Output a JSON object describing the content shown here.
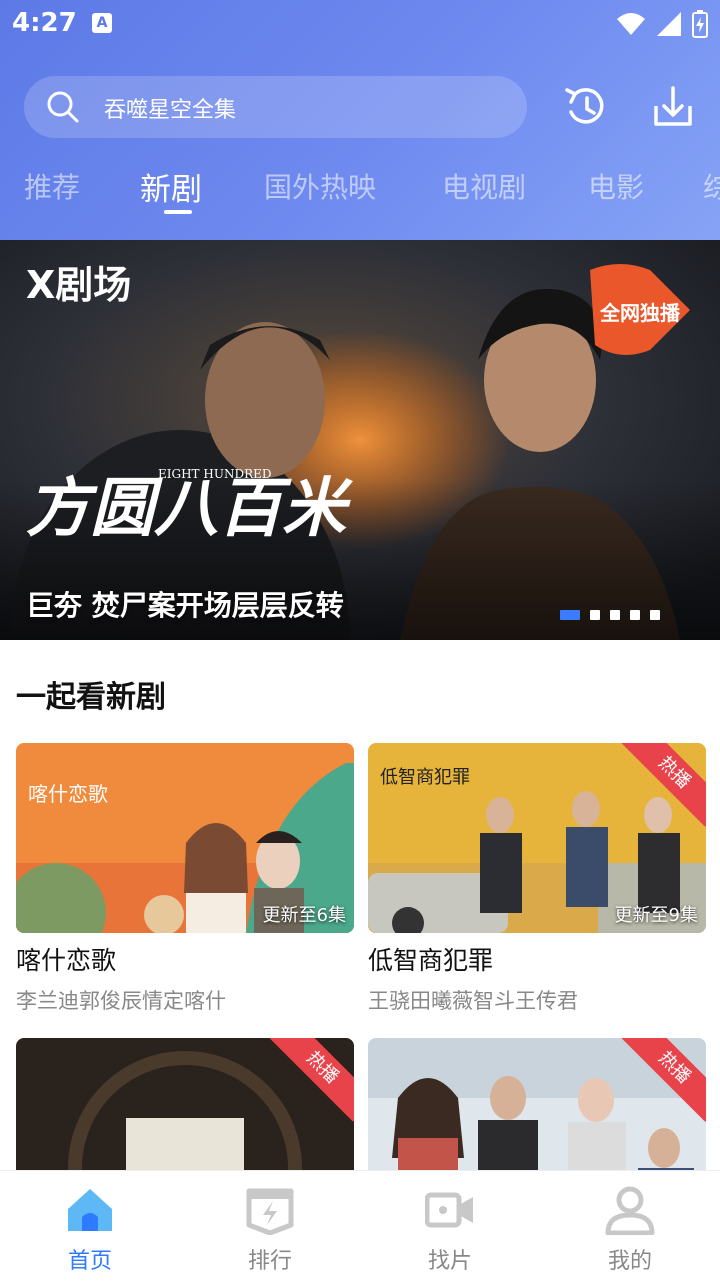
{
  "status_bar": {
    "time": "4:27",
    "notification_icon": "A"
  },
  "search": {
    "placeholder": "吞噬星空全集"
  },
  "header_actions": [
    {
      "icon": "history-icon"
    },
    {
      "icon": "download-icon"
    }
  ],
  "tabs": [
    {
      "label": "推荐",
      "active": false
    },
    {
      "label": "新剧",
      "active": true
    },
    {
      "label": "国外热映",
      "active": false
    },
    {
      "label": "电视剧",
      "active": false
    },
    {
      "label": "电影",
      "active": false
    },
    {
      "label": "综",
      "active": false
    }
  ],
  "banner": {
    "channel_logo": "X剧场",
    "title_art": "方圆八百米",
    "title_art_en": "EIGHT HUNDRED",
    "badge": "全网独播",
    "caption": "巨夯 焚尸案开场层层反转",
    "slide_count": 5,
    "active_slide": 1
  },
  "section": {
    "title": "一起看新剧",
    "cards": [
      {
        "title": "喀什恋歌",
        "subtitle": "李兰迪郭俊辰情定喀什",
        "update": "更新至6集",
        "hot": "",
        "poster_text": "喀什恋歌"
      },
      {
        "title": "低智商犯罪",
        "subtitle": "王骁田曦薇智斗王传君",
        "update": "更新至9集",
        "hot": "热播",
        "poster_text": "低智商犯罪"
      },
      {
        "title": "",
        "subtitle": "",
        "update": "",
        "hot": "热播",
        "poster_text": ""
      },
      {
        "title": "",
        "subtitle": "",
        "update": "",
        "hot": "热播",
        "poster_text": ""
      }
    ]
  },
  "bottom_nav": [
    {
      "label": "首页",
      "icon": "home-icon",
      "active": true
    },
    {
      "label": "排行",
      "icon": "ranking-icon",
      "active": false
    },
    {
      "label": "找片",
      "icon": "video-camera-icon",
      "active": false
    },
    {
      "label": "我的",
      "icon": "profile-icon",
      "active": false
    }
  ],
  "colors": {
    "accent": "#2f7bff",
    "header_start": "#5d79e6",
    "hot_ribbon": "#e8434a"
  }
}
